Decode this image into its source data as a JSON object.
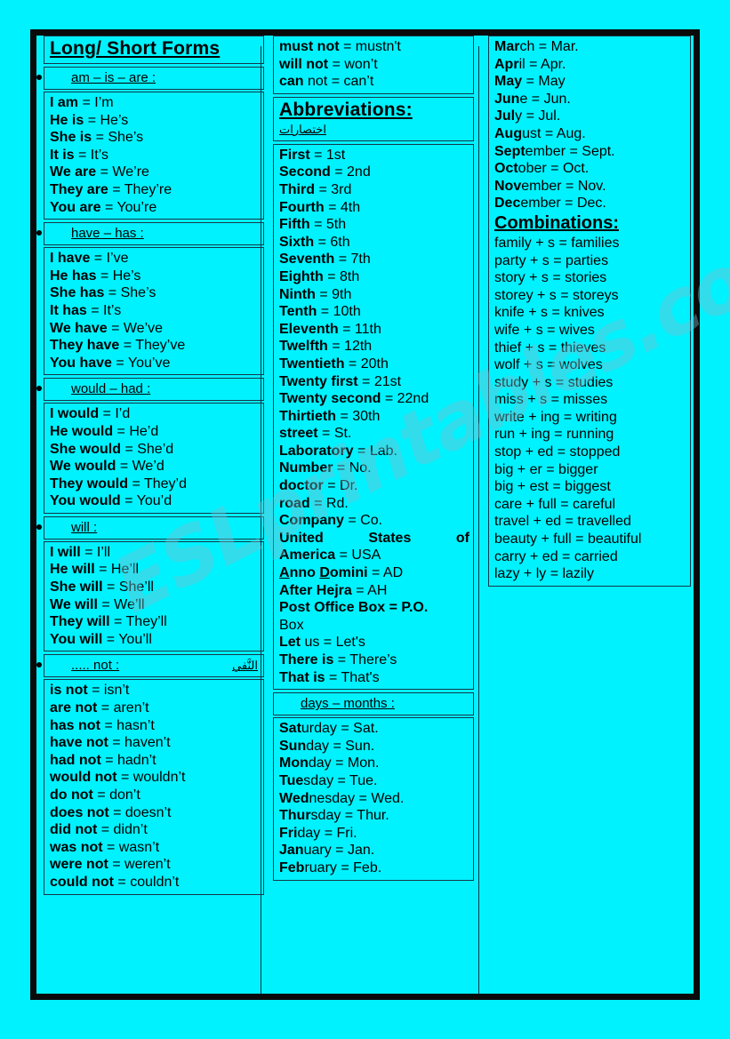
{
  "page": {
    "background_color": "#00F2FF",
    "text_color": "#000000",
    "border_color": "#16364a",
    "watermark": "ESLprintables.com"
  },
  "column1": {
    "title": "Long/ Short Forms",
    "sections": [
      {
        "header": "am – is – are :",
        "header_ar": "",
        "rows": [
          {
            "bold": "I am",
            "rest": " = I’m"
          },
          {
            "bold": "He is",
            "rest": " = He’s"
          },
          {
            "bold": "She is",
            "rest": " = She’s"
          },
          {
            "bold": "It is",
            "rest": " = It’s"
          },
          {
            "bold": "We are",
            "rest": " = We’re"
          },
          {
            "bold": "They are",
            "rest": " = They’re"
          },
          {
            "bold": "You are",
            "rest": "  = You’re"
          }
        ]
      },
      {
        "header": "have – has :",
        "header_ar": "",
        "rows": [
          {
            "bold": "I have",
            "rest": " = I’ve"
          },
          {
            "bold": "He has",
            "rest": " = He’s"
          },
          {
            "bold": "She has",
            "rest": " = She’s"
          },
          {
            "bold": "It has",
            "rest": " = It’s"
          },
          {
            "bold": "We have",
            "rest": " = We’ve"
          },
          {
            "bold": "They have",
            "rest": " = They’ve"
          },
          {
            "bold": "You have",
            "rest": " = You’ve"
          }
        ]
      },
      {
        "header": "would – had :",
        "header_ar": "",
        "rows": [
          {
            "bold": "I would",
            "rest": " = I’d"
          },
          {
            "bold": "He would",
            "rest": " = He’d"
          },
          {
            "bold": "She would",
            "rest": " = She’d"
          },
          {
            "bold": "We would",
            "rest": " = We’d"
          },
          {
            "bold": "They would",
            "rest": " = They’d"
          },
          {
            "bold": "You would",
            "rest": " = You’d"
          }
        ]
      },
      {
        "header": "will :",
        "header_ar": "",
        "rows": [
          {
            "bold": "I will",
            "rest": " = I’ll"
          },
          {
            "bold": "He will",
            "rest": " = He’ll"
          },
          {
            "bold": "She will",
            "rest": " = She’ll"
          },
          {
            "bold": "We will",
            "rest": " = We’ll"
          },
          {
            "bold": "They will",
            "rest": " = They’ll"
          },
          {
            "bold": "You will",
            "rest": " = You’ll"
          }
        ]
      },
      {
        "header": "..... not :",
        "header_ar": "النَّفي",
        "rows": [
          {
            "bold": "is not",
            "rest": " = isn’t"
          },
          {
            "bold": "are not",
            "rest": " = aren’t"
          },
          {
            "bold": "has not",
            "rest": " = hasn’t"
          },
          {
            "bold": "have not",
            "rest": " = haven’t"
          },
          {
            "bold": "had not",
            "rest": " = hadn’t"
          },
          {
            "bold": "would not",
            "rest": " = wouldn’t"
          },
          {
            "bold": "do not",
            "rest": " = don’t"
          },
          {
            "bold": "does not",
            "rest": " = doesn’t"
          },
          {
            "bold": "did not",
            "rest": " = didn’t"
          },
          {
            "bold": "was not",
            "rest": " = wasn’t"
          },
          {
            "bold": "were not",
            "rest": " = weren’t"
          },
          {
            "bold": "could not",
            "rest": " = couldn’t"
          }
        ]
      }
    ]
  },
  "column2": {
    "not_continued": [
      {
        "bold": "must not",
        "rest": " = mustn't"
      },
      {
        "bold": "will not",
        "rest": " = won’t"
      },
      {
        "bold": "can",
        "rest": " not = can’t"
      }
    ],
    "abbrev_title": "Abbreviations:",
    "abbrev_title_ar": "اختصارات",
    "abbrev_rows": [
      {
        "bold": "First",
        "rest": " = 1st"
      },
      {
        "bold": "Second",
        "rest": " = 2nd"
      },
      {
        "bold": "Third",
        "rest": " = 3rd"
      },
      {
        "bold": "Fourth",
        "rest": " = 4th"
      },
      {
        "bold": "Fifth",
        "rest": " = 5th"
      },
      {
        "bold": "Sixth",
        "rest": " = 6th"
      },
      {
        "bold": "Seventh",
        "rest": " = 7th"
      },
      {
        "bold": "Eighth",
        "rest": " = 8th"
      },
      {
        "bold": "Ninth",
        "rest": " = 9th"
      },
      {
        "bold": "Tenth",
        "rest": " = 10th"
      },
      {
        "bold": "Eleventh",
        "rest": " = 11th"
      },
      {
        "bold": "Twelfth",
        "rest": " = 12th"
      },
      {
        "bold": "Twentieth",
        "rest": " = 20th"
      },
      {
        "bold": "Twenty first",
        "rest": " = 21st"
      },
      {
        "bold": "Twenty second",
        "rest": " = 22nd"
      },
      {
        "bold": "Thirtieth",
        "rest": " = 30th"
      },
      {
        "bold": "street",
        "rest": " = St."
      },
      {
        "bold": "Laboratory",
        "rest": " = Lab."
      },
      {
        "bold": "Number",
        "rest": " = No."
      },
      {
        "bold": "doctor",
        "rest": " = Dr."
      },
      {
        "bold": "road",
        "rest": " = Rd."
      },
      {
        "bold": "Company",
        "rest": " = Co."
      }
    ],
    "usa_line1": "United States of",
    "usa_line2_bold": "America",
    "usa_line2_rest": " = USA",
    "abbrev_rows2": [
      {
        "bold": "Anno Domini",
        "rest": " = AD",
        "underline_initials": true
      },
      {
        "bold": "After Hejra",
        "rest": " = AH"
      }
    ],
    "pobox_line1": "Post Office Box =   P.O.",
    "pobox_line2": "Box",
    "abbrev_rows3": [
      {
        "bold": "Let",
        "rest": " us = Let's"
      },
      {
        "bold": "There is",
        "rest": " = There’s"
      },
      {
        "bold": "That is",
        "rest": " = That's"
      }
    ],
    "days_header": "days – months :",
    "days_rows": [
      {
        "bold": "Sat",
        "mid": "urday",
        "rest": " = Sat."
      },
      {
        "bold": "Sun",
        "mid": "day",
        "rest": " = Sun."
      },
      {
        "bold": "Mon",
        "mid": "day",
        "rest": " = Mon."
      },
      {
        "bold": "Tue",
        "mid": "sday",
        "rest": " = Tue."
      },
      {
        "bold": "Wed",
        "mid": "nesday",
        "rest": " = Wed."
      },
      {
        "bold": "Thur",
        "mid": "sday",
        "rest": " = Thur."
      },
      {
        "bold": "Fri",
        "mid": "day",
        "rest": " = Fri."
      },
      {
        "bold": "Jan",
        "mid": "uary",
        "rest": " = Jan."
      },
      {
        "bold": "Feb",
        "mid": "ruary",
        "rest": " = Feb."
      }
    ]
  },
  "column3": {
    "months_rows": [
      {
        "bold": "Mar",
        "mid": "ch",
        "rest": " = Mar."
      },
      {
        "bold": "Apr",
        "mid": "il",
        "rest": " = Apr."
      },
      {
        "bold": "May",
        "mid": "",
        "rest": " = May"
      },
      {
        "bold": "Jun",
        "mid": "e",
        "rest": " = Jun."
      },
      {
        "bold": "Jul",
        "mid": "y",
        "rest": " = Jul."
      },
      {
        "bold": "Aug",
        "mid": "ust",
        "rest": " = Aug."
      },
      {
        "bold": "Sept",
        "mid": "ember",
        "rest": " = Sept."
      },
      {
        "bold": "Oct",
        "mid": "ober",
        "rest": " = Oct."
      },
      {
        "bold": "Nov",
        "mid": "ember",
        "rest": " = Nov."
      },
      {
        "bold": "Dec",
        "mid": "ember",
        "rest": " = Dec."
      }
    ],
    "combinations_title": "Combinations:",
    "combinations_rows": [
      "family + s = families",
      "party + s = parties",
      "story + s = stories",
      "storey + s = storeys",
      "knife  + s = knives",
      "wife + s = wives",
      "thief + s = thieves",
      "wolf + s = wolves",
      "study + s = studies",
      "miss + s = misses",
      "write + ing = writing",
      "run + ing = running",
      "stop + ed = stopped",
      "big + er = bigger",
      "big + est = biggest",
      "care + full = careful",
      "travel + ed = travelled",
      "beauty + full = beautiful",
      "carry + ed = carried",
      "lazy + ly = lazily"
    ]
  }
}
